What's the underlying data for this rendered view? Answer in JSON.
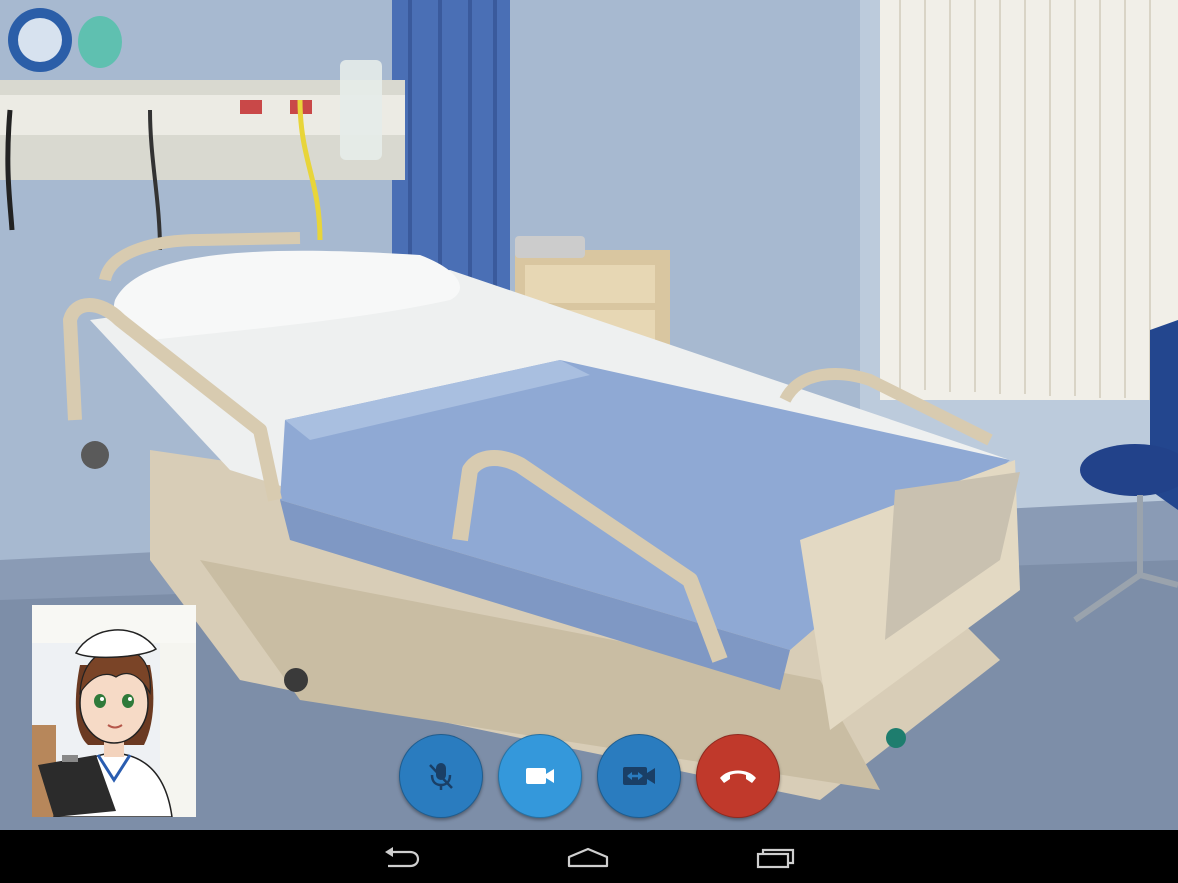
{
  "call": {
    "remote_video": {
      "description_icon": "remote-video-feed",
      "scene": "hospital-room"
    },
    "self_view": {
      "icon": "nurse-avatar"
    },
    "controls": [
      {
        "name": "mute-microphone-button",
        "icon": "microphone-off-icon",
        "color": "#2a7cbf"
      },
      {
        "name": "video-toggle-button",
        "icon": "video-camera-icon",
        "color": "#3498db"
      },
      {
        "name": "switch-camera-button",
        "icon": "switch-camera-icon",
        "color": "#2a7cbf"
      },
      {
        "name": "end-call-button",
        "icon": "phone-hangup-icon",
        "color": "#c0392b"
      }
    ]
  },
  "navbar": {
    "buttons": [
      {
        "name": "back-button",
        "icon": "back-arrow-icon"
      },
      {
        "name": "home-button",
        "icon": "home-icon"
      },
      {
        "name": "recents-button",
        "icon": "recent-apps-icon"
      }
    ]
  }
}
